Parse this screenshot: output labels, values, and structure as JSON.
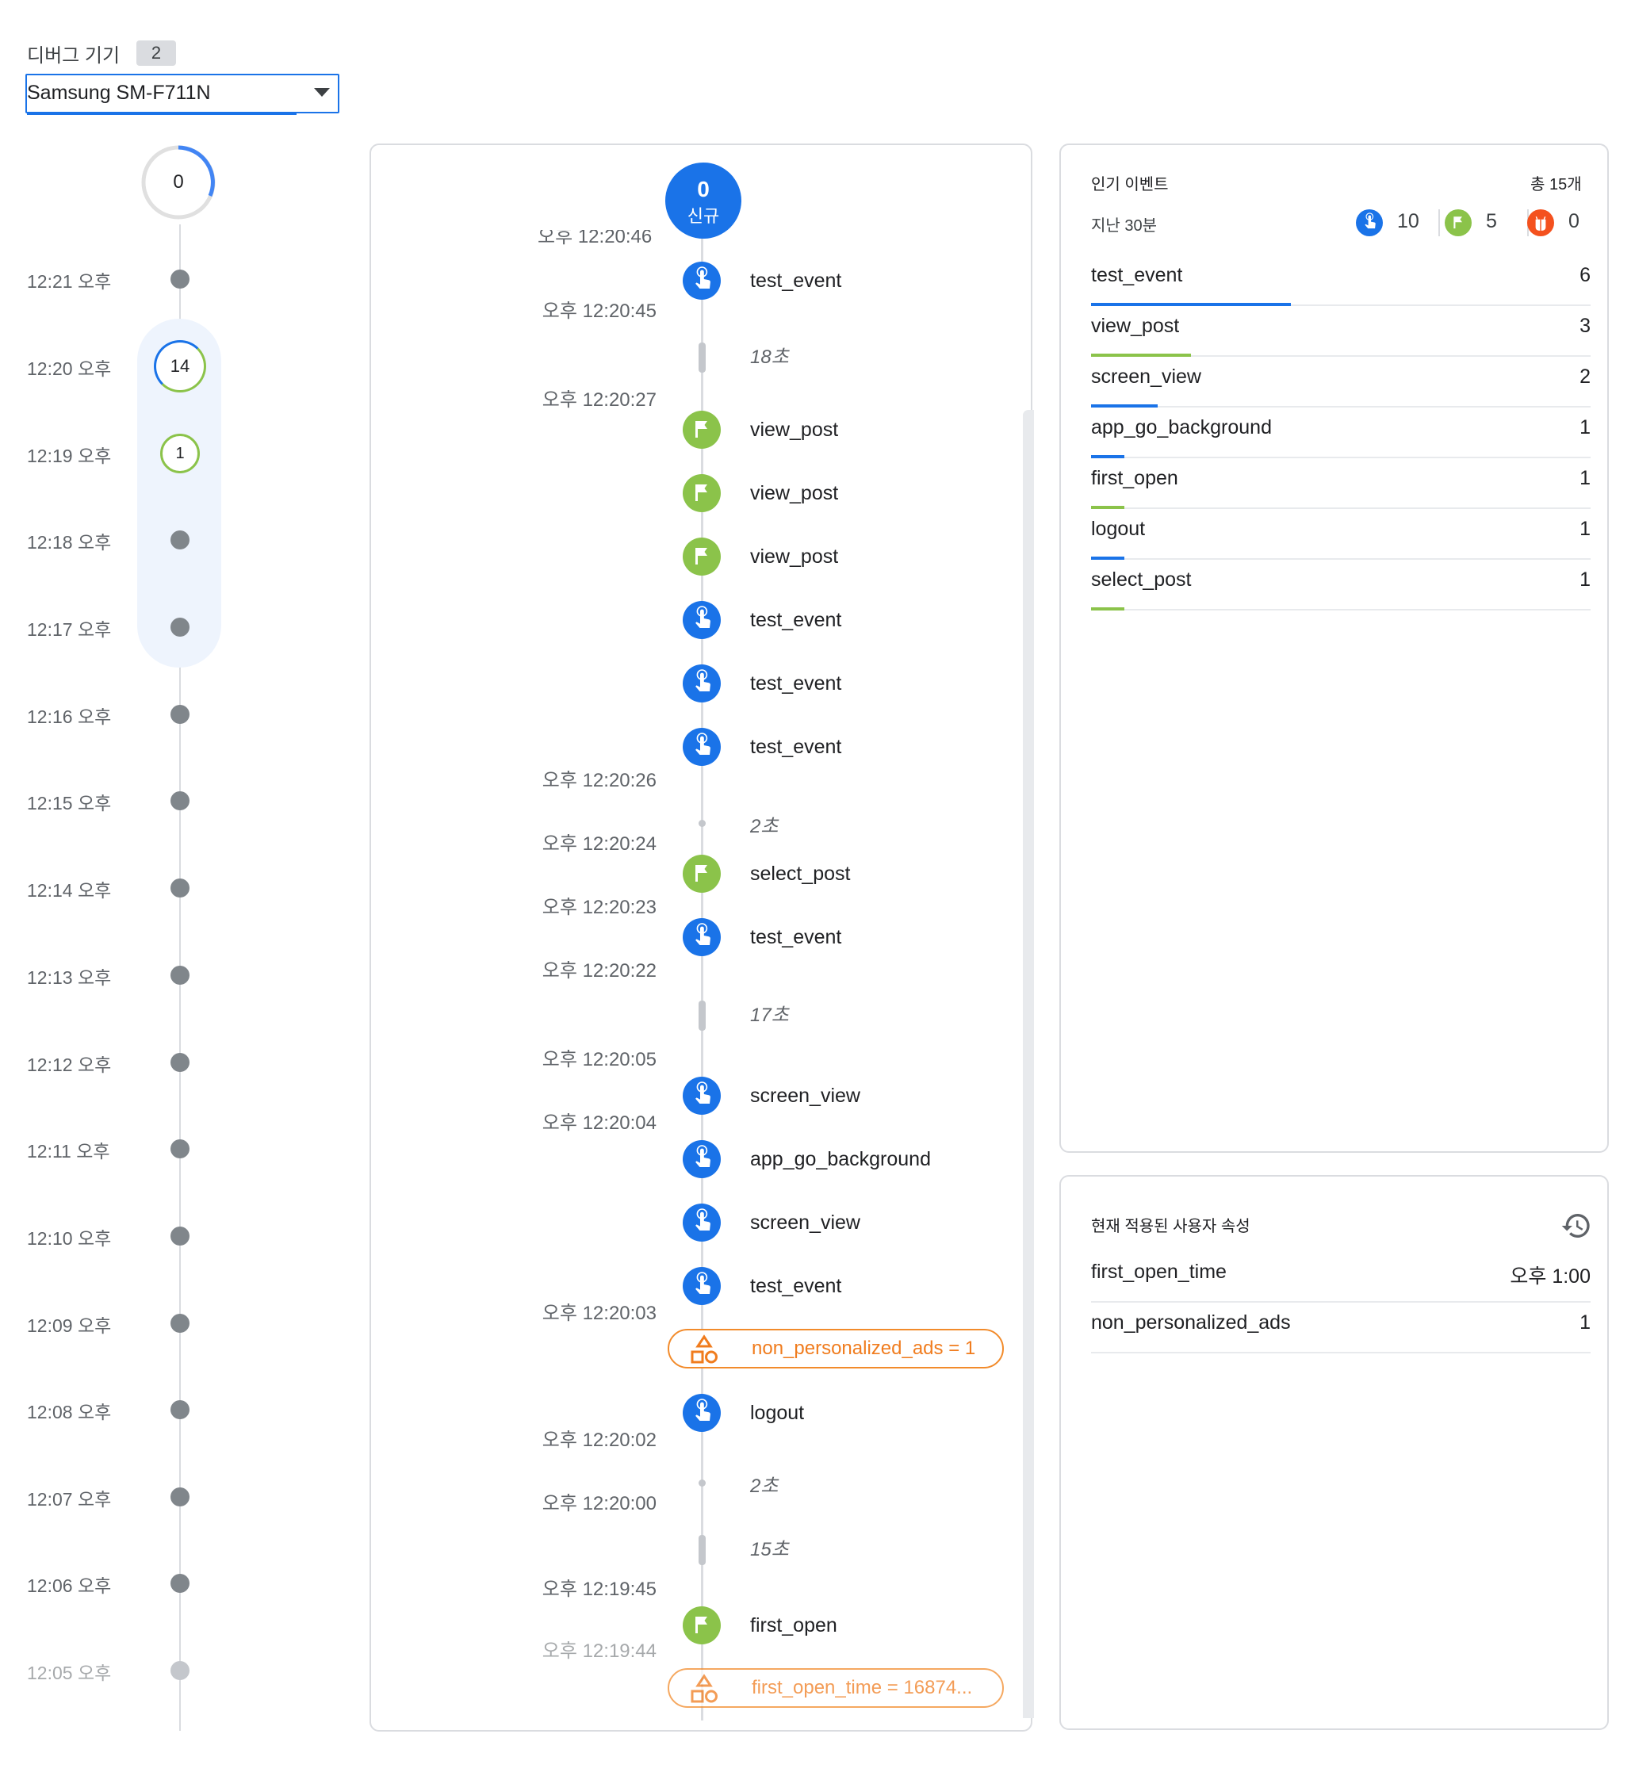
{
  "device": {
    "title": "디버그 기기",
    "count": "2",
    "selected": "Samsung SM-F711N"
  },
  "minute_timeline": {
    "top_count": "0",
    "minutes": [
      {
        "label": "12:21 오후"
      },
      {
        "label": "12:20 오후",
        "count": "14",
        "ring": "#1a73e8"
      },
      {
        "label": "12:19 오후",
        "count": "1",
        "ring": "#8bc34a"
      },
      {
        "label": "12:18 오후"
      },
      {
        "label": "12:17 오후"
      },
      {
        "label": "12:16 오후"
      },
      {
        "label": "12:15 오후"
      },
      {
        "label": "12:14 오후"
      },
      {
        "label": "12:13 오후"
      },
      {
        "label": "12:12 오후"
      },
      {
        "label": "12:11 오후"
      },
      {
        "label": "12:10 오후"
      },
      {
        "label": "12:09 오후"
      },
      {
        "label": "12:08 오후"
      },
      {
        "label": "12:07 오후"
      },
      {
        "label": "12:06 오후"
      },
      {
        "label": "12:05 오후"
      }
    ]
  },
  "stream": {
    "new_count": "0",
    "new_label": "신규",
    "clipped_time": "오후 12:20:46",
    "timestamps": [
      "오후 12:20:45",
      "오후 12:20:27",
      "오후 12:20:26",
      "오후 12:20:24",
      "오후 12:20:23",
      "오후 12:20:22",
      "오후 12:20:05",
      "오후 12:20:04",
      "오후 12:20:03",
      "오후 12:20:02",
      "오후 12:20:00",
      "오후 12:19:45",
      "오후 12:19:44"
    ],
    "events": [
      {
        "name": "test_event",
        "kind": "custom"
      },
      {
        "name": "view_post",
        "kind": "conversion"
      },
      {
        "name": "view_post",
        "kind": "conversion"
      },
      {
        "name": "view_post",
        "kind": "conversion"
      },
      {
        "name": "test_event",
        "kind": "custom"
      },
      {
        "name": "test_event",
        "kind": "custom"
      },
      {
        "name": "test_event",
        "kind": "custom"
      },
      {
        "name": "select_post",
        "kind": "conversion"
      },
      {
        "name": "test_event",
        "kind": "custom"
      },
      {
        "name": "screen_view",
        "kind": "custom"
      },
      {
        "name": "app_go_background",
        "kind": "custom"
      },
      {
        "name": "screen_view",
        "kind": "custom"
      },
      {
        "name": "test_event",
        "kind": "custom"
      },
      {
        "name": "logout",
        "kind": "custom"
      },
      {
        "name": "first_open",
        "kind": "conversion"
      }
    ],
    "gaps": [
      "18초",
      "2초",
      "17초",
      "2초",
      "15초"
    ],
    "properties": [
      "non_personalized_ads = 1",
      "first_open_time = 16874..."
    ]
  },
  "top_events": {
    "title": "인기 이벤트",
    "total": "총 15개",
    "period": "지난 30분",
    "legend": [
      {
        "icon": "touch-icon",
        "count": "10",
        "color": "#1a73e8"
      },
      {
        "icon": "flag-icon",
        "count": "5",
        "color": "#8bc34a"
      },
      {
        "icon": "error-icon",
        "count": "0",
        "color": "#f4511e"
      }
    ],
    "rows": [
      {
        "name": "test_event",
        "count": "6",
        "share": 0.4,
        "color": "#1a73e8"
      },
      {
        "name": "view_post",
        "count": "3",
        "share": 0.2,
        "color": "#8bc34a"
      },
      {
        "name": "screen_view",
        "count": "2",
        "share": 0.133,
        "color": "#1a73e8"
      },
      {
        "name": "app_go_background",
        "count": "1",
        "share": 0.067,
        "color": "#1a73e8"
      },
      {
        "name": "first_open",
        "count": "1",
        "share": 0.067,
        "color": "#8bc34a"
      },
      {
        "name": "logout",
        "count": "1",
        "share": 0.067,
        "color": "#1a73e8"
      },
      {
        "name": "select_post",
        "count": "1",
        "share": 0.067,
        "color": "#8bc34a"
      }
    ]
  },
  "user_properties": {
    "title": "현재 적용된 사용자 속성",
    "rows": [
      {
        "name": "first_open_time",
        "value": "오후 1:00"
      },
      {
        "name": "non_personalized_ads",
        "value": "1"
      }
    ]
  }
}
